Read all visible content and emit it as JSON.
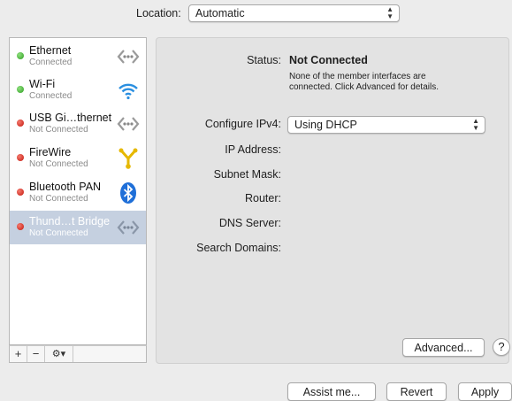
{
  "location": {
    "label": "Location:",
    "value": "Automatic"
  },
  "services": [
    {
      "name": "Ethernet",
      "status": "Connected",
      "state": "green",
      "icon": "ethernet-icon"
    },
    {
      "name": "Wi-Fi",
      "status": "Connected",
      "state": "green",
      "icon": "wifi-icon"
    },
    {
      "name": "USB Gi…thernet",
      "status": "Not Connected",
      "state": "red",
      "icon": "ethernet-icon"
    },
    {
      "name": "FireWire",
      "status": "Not Connected",
      "state": "red",
      "icon": "firewire-icon"
    },
    {
      "name": "Bluetooth PAN",
      "status": "Not Connected",
      "state": "red",
      "icon": "bluetooth-icon"
    },
    {
      "name": "Thund…t Bridge",
      "status": "Not Connected",
      "state": "red",
      "icon": "ethernet-icon",
      "selected": true
    }
  ],
  "sidebar_controls": {
    "add": "+",
    "remove": "−",
    "gear": "⚙▾"
  },
  "detail": {
    "status_label": "Status:",
    "status_value": "Not Connected",
    "status_desc": "None of the member interfaces are connected. Click Advanced for details.",
    "configure_label": "Configure IPv4:",
    "configure_value": "Using DHCP",
    "ip_label": "IP Address:",
    "subnet_label": "Subnet Mask:",
    "router_label": "Router:",
    "dns_label": "DNS Server:",
    "search_label": "Search Domains:",
    "advanced": "Advanced...",
    "help": "?"
  },
  "footer": {
    "assist": "Assist me...",
    "revert": "Revert",
    "apply": "Apply"
  },
  "colors": {
    "selected_row": "#c5d0e0",
    "connected": "#2f9e23",
    "not_connected": "#c4170c"
  }
}
